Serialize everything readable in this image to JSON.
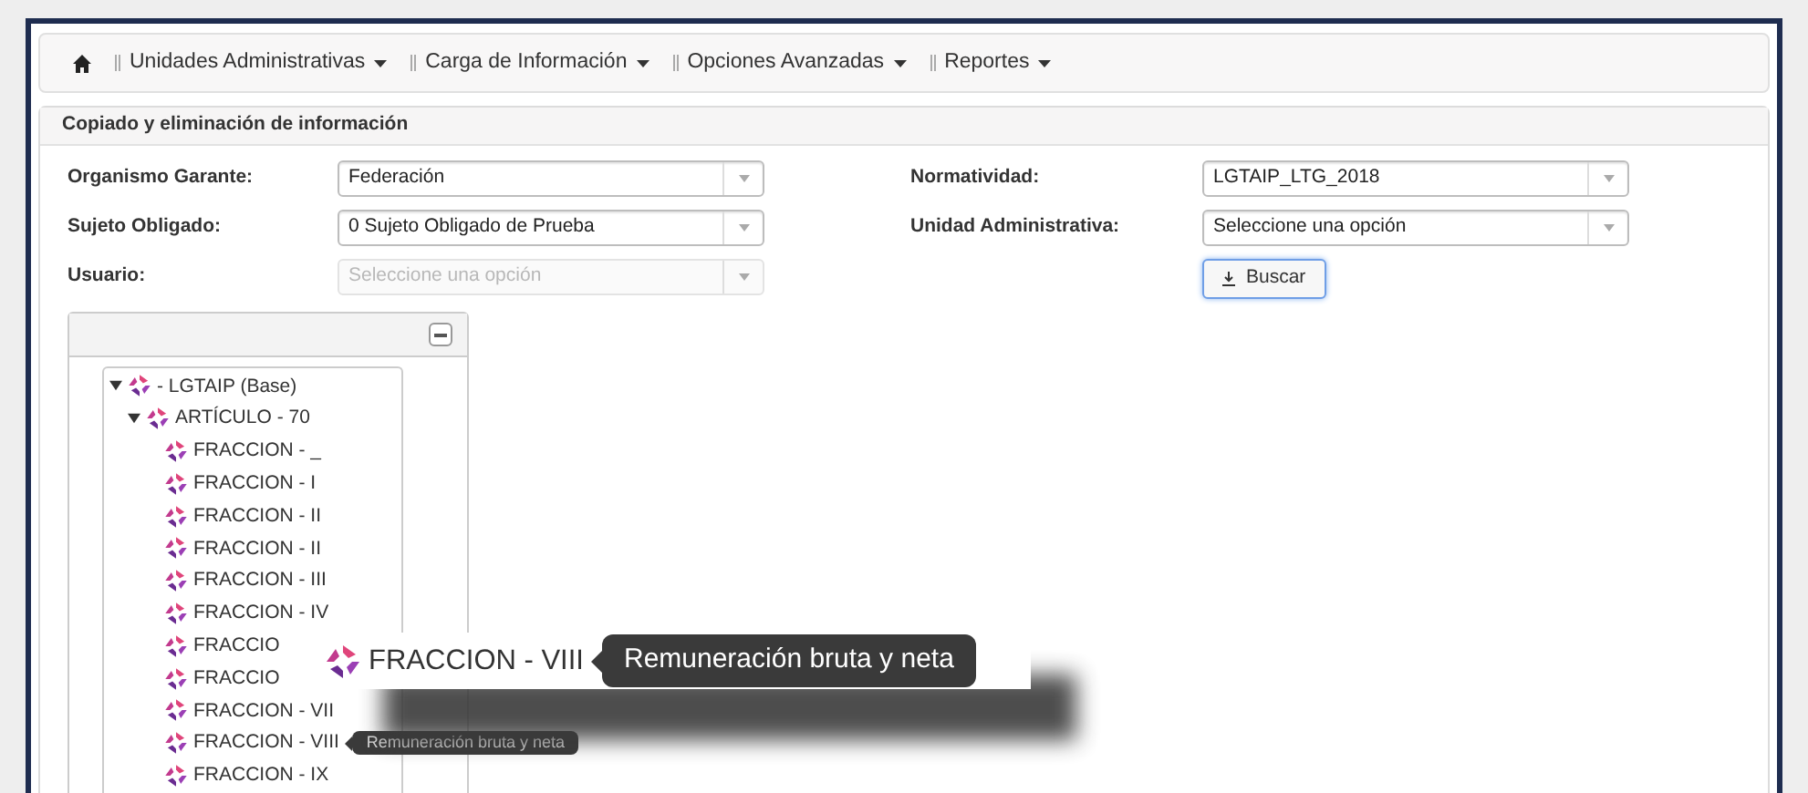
{
  "nav": {
    "items": [
      {
        "label": "Unidades Administrativas"
      },
      {
        "label": "Carga de Información"
      },
      {
        "label": "Opciones Avanzadas"
      },
      {
        "label": "Reportes"
      }
    ]
  },
  "panel": {
    "title": "Copiado y eliminación de información"
  },
  "form": {
    "left": [
      {
        "label": "Organismo Garante:",
        "value": "Federación",
        "disabled": false
      },
      {
        "label": "Sujeto Obligado:",
        "value": "0 Sujeto Obligado de Prueba",
        "disabled": false
      },
      {
        "label": "Usuario:",
        "value": "Seleccione una opción",
        "disabled": true
      }
    ],
    "right": [
      {
        "label": "Normatividad:",
        "value": "LGTAIP_LTG_2018",
        "disabled": false
      },
      {
        "label": "Unidad Administrativa:",
        "value": "Seleccione una opción",
        "disabled": false
      }
    ],
    "search_button": "Buscar"
  },
  "tree": [
    {
      "label": "- LGTAIP (Base)",
      "expanded": true,
      "children": [
        {
          "label": "ARTÍCULO - 70",
          "expanded": true,
          "children": [
            {
              "label": "FRACCION - _"
            },
            {
              "label": "FRACCION - I"
            },
            {
              "label": "FRACCION - II"
            },
            {
              "label": "FRACCION - II"
            },
            {
              "label": "FRACCION - III"
            },
            {
              "label": "FRACCION - IV"
            },
            {
              "label": "FRACCIO"
            },
            {
              "label": "FRACCIO"
            },
            {
              "label": "FRACCION - VII"
            },
            {
              "label": "FRACCION - VIII",
              "tooltip": "Remuneración bruta y neta"
            },
            {
              "label": "FRACCION - IX"
            }
          ]
        }
      ]
    }
  ],
  "magnifier": {
    "label": "FRACCION - VIII",
    "tooltip": "Remuneración bruta y neta"
  }
}
